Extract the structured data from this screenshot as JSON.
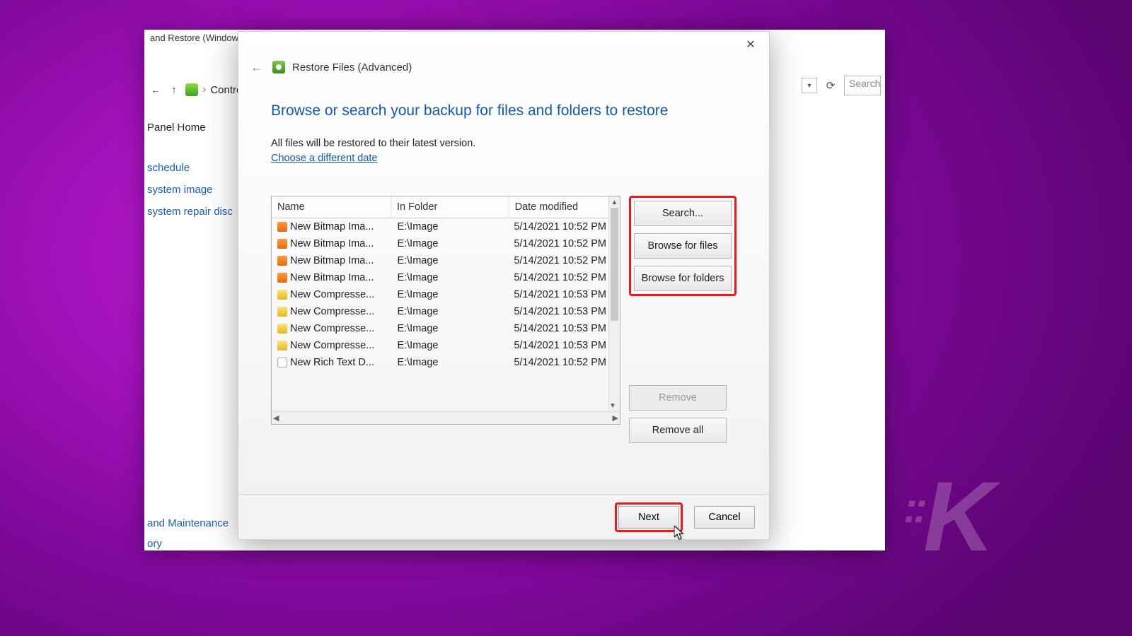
{
  "outer": {
    "title_fragment": "and Restore (Window",
    "breadcrumb_fragment": "Contro",
    "search_placeholder": "Search"
  },
  "sidebar": {
    "home": "Panel Home",
    "items": [
      "schedule",
      "system image",
      "system repair disc"
    ],
    "lower": [
      "and Maintenance",
      "ory"
    ]
  },
  "dialog": {
    "title": "Restore Files (Advanced)",
    "heading": "Browse or search your backup for files and folders to restore",
    "subtext": "All files will be restored to their latest version.",
    "link": "Choose a different date",
    "columns": {
      "name": "Name",
      "folder": "In Folder",
      "date": "Date modified"
    },
    "rows": [
      {
        "icon": "bmp",
        "name": "New Bitmap Ima...",
        "folder": "E:\\Image",
        "date": "5/14/2021 10:52 PM"
      },
      {
        "icon": "bmp",
        "name": "New Bitmap Ima...",
        "folder": "E:\\Image",
        "date": "5/14/2021 10:52 PM"
      },
      {
        "icon": "bmp",
        "name": "New Bitmap Ima...",
        "folder": "E:\\Image",
        "date": "5/14/2021 10:52 PM"
      },
      {
        "icon": "bmp",
        "name": "New Bitmap Ima...",
        "folder": "E:\\Image",
        "date": "5/14/2021 10:52 PM"
      },
      {
        "icon": "zip",
        "name": "New Compresse...",
        "folder": "E:\\Image",
        "date": "5/14/2021 10:53 PM"
      },
      {
        "icon": "zip",
        "name": "New Compresse...",
        "folder": "E:\\Image",
        "date": "5/14/2021 10:53 PM"
      },
      {
        "icon": "zip",
        "name": "New Compresse...",
        "folder": "E:\\Image",
        "date": "5/14/2021 10:53 PM"
      },
      {
        "icon": "zip",
        "name": "New Compresse...",
        "folder": "E:\\Image",
        "date": "5/14/2021 10:53 PM"
      },
      {
        "icon": "rtf",
        "name": "New Rich Text D...",
        "folder": "E:\\Image",
        "date": "5/14/2021 10:52 PM"
      }
    ],
    "buttons": {
      "search": "Search...",
      "browse_files": "Browse for files",
      "browse_folders": "Browse for folders",
      "remove": "Remove",
      "remove_all": "Remove all",
      "next": "Next",
      "cancel": "Cancel"
    }
  },
  "watermark": "K"
}
